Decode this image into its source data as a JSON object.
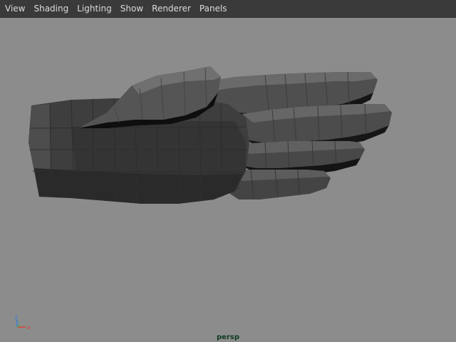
{
  "menubar": {
    "items": [
      "View",
      "Shading",
      "Lighting",
      "Show",
      "Renderer",
      "Panels"
    ]
  },
  "viewport": {
    "camera": "persp",
    "axis": {
      "z": "z",
      "x": "x",
      "z_color": "#2e7dd6",
      "x_color": "#e03a2e",
      "y_color": "#38c040"
    },
    "background": "#8c8c8c",
    "model": "hand-mesh"
  }
}
